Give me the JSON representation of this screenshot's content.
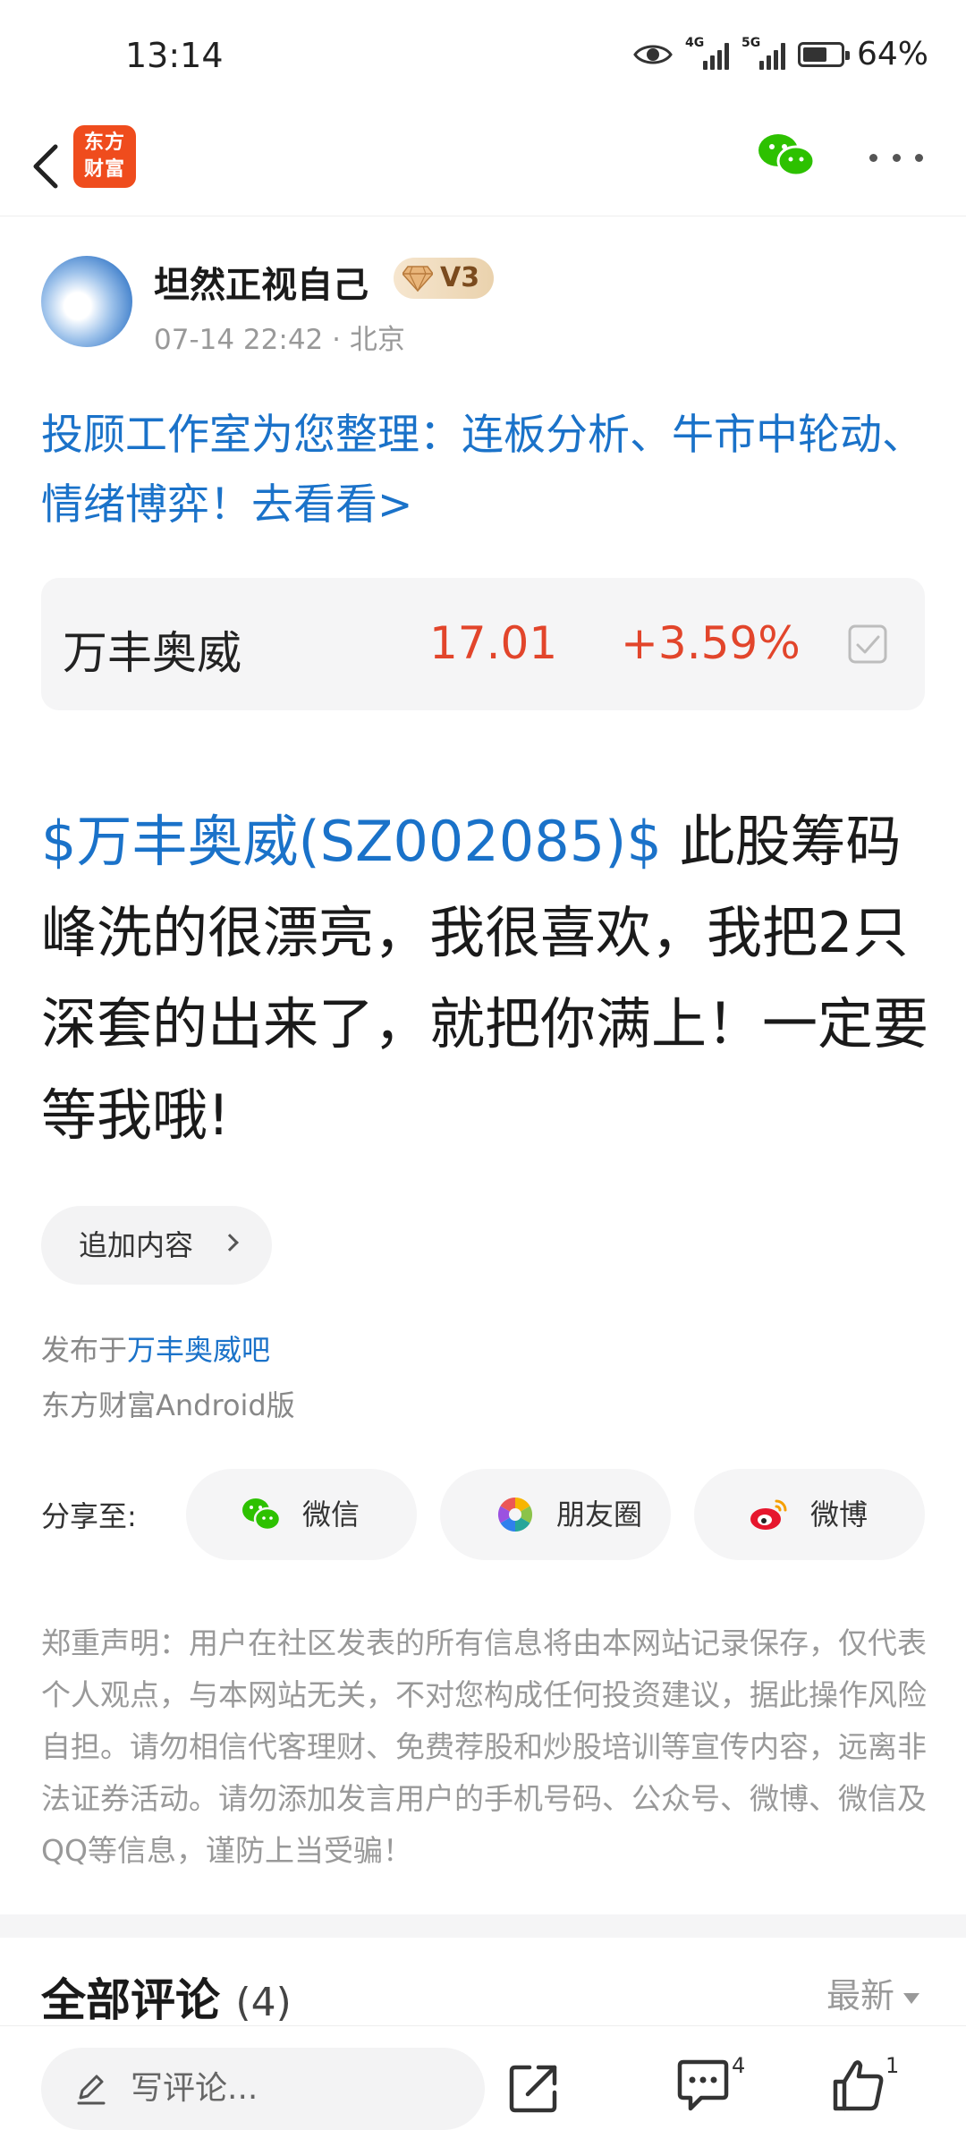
{
  "status_bar": {
    "time": "13:14",
    "network_1": "4G",
    "network_2": "5G",
    "battery": "64%",
    "battery_level": 0.64
  },
  "header": {
    "logo_text_line1": "东方",
    "logo_text_line2": "财富",
    "brand_color": "#ef4c1d"
  },
  "author": {
    "name": "坦然正视自己",
    "level_badge": "V3",
    "timestamp": "07-14 22:42",
    "separator": "·",
    "location": "北京"
  },
  "promo_link": "投顾工作室为您整理：连板分析、牛市中轮动、情绪博弈！去看看>",
  "stock_card": {
    "name": "万丰奥威",
    "price": "17.01",
    "change": "+3.59%",
    "up_color": "#e2452b"
  },
  "post": {
    "stock_tag": "$万丰奥威(SZ002085)$",
    "text": " 此股筹码峰洗的很漂亮，我很喜欢，我把2只深套的出来了，就把你满上！一定要等我哦!"
  },
  "append_button": "追加内容",
  "published": {
    "prefix": "发布于",
    "bar_name": "万丰奥威吧",
    "client": "东方财富Android版"
  },
  "share": {
    "label": "分享至:",
    "targets": [
      "微信",
      "朋友圈",
      "微博"
    ]
  },
  "disclaimer": "郑重声明：用户在社区发表的所有信息将由本网站记录保存，仅代表个人观点，与本网站无关，不对您构成任何投资建议，据此操作风险自担。请勿相信代客理财、免费荐股和炒股培训等宣传内容，远离非法证券活动。请勿添加发言用户的手机号码、公众号、微博、微信及QQ等信息，谨防上当受骗！",
  "comments": {
    "title": "全部评论",
    "count": "(4)",
    "sort": "最新"
  },
  "bottom_bar": {
    "input_placeholder": "写评论...",
    "comment_count": "4",
    "like_count": "1"
  },
  "link_color": "#1a72c9"
}
